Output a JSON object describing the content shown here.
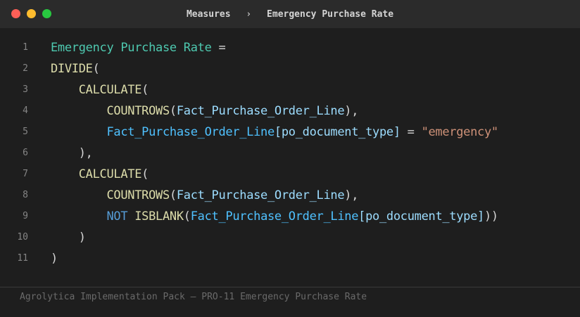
{
  "window": {
    "breadcrumb": [
      "Measures",
      "Emergency Purchase Rate"
    ],
    "breadcrumb_separator": "›",
    "traffic_lights": [
      "close",
      "minimize",
      "maximize"
    ]
  },
  "editor": {
    "line_numbers": [
      "1",
      "2",
      "3",
      "4",
      "5",
      "6",
      "7",
      "8",
      "9",
      "10",
      "11"
    ],
    "lines": [
      [
        {
          "t": "Emergency Purchase Rate",
          "c": "measure"
        },
        {
          "t": " =",
          "c": "op"
        }
      ],
      [
        {
          "t": "DIVIDE",
          "c": "func"
        },
        {
          "t": "(",
          "c": "op"
        }
      ],
      [
        {
          "t": "    ",
          "c": "op"
        },
        {
          "t": "CALCULATE",
          "c": "func"
        },
        {
          "t": "(",
          "c": "op"
        }
      ],
      [
        {
          "t": "        ",
          "c": "op"
        },
        {
          "t": "COUNTROWS",
          "c": "func"
        },
        {
          "t": "(",
          "c": "op"
        },
        {
          "t": "Fact_Purchase_Order_Line",
          "c": "col"
        },
        {
          "t": "),",
          "c": "op"
        }
      ],
      [
        {
          "t": "        ",
          "c": "op"
        },
        {
          "t": "Fact_Purchase_Order_Line",
          "c": "ref"
        },
        {
          "t": "[po_document_type]",
          "c": "col"
        },
        {
          "t": " = ",
          "c": "op"
        },
        {
          "t": "\"emergency\"",
          "c": "str"
        }
      ],
      [
        {
          "t": "    ),",
          "c": "op"
        }
      ],
      [
        {
          "t": "    ",
          "c": "op"
        },
        {
          "t": "CALCULATE",
          "c": "func"
        },
        {
          "t": "(",
          "c": "op"
        }
      ],
      [
        {
          "t": "        ",
          "c": "op"
        },
        {
          "t": "COUNTROWS",
          "c": "func"
        },
        {
          "t": "(",
          "c": "op"
        },
        {
          "t": "Fact_Purchase_Order_Line",
          "c": "col"
        },
        {
          "t": "),",
          "c": "op"
        }
      ],
      [
        {
          "t": "        ",
          "c": "op"
        },
        {
          "t": "NOT",
          "c": "kw"
        },
        {
          "t": " ",
          "c": "op"
        },
        {
          "t": "ISBLANK",
          "c": "func"
        },
        {
          "t": "(",
          "c": "op"
        },
        {
          "t": "Fact_Purchase_Order_Line",
          "c": "ref"
        },
        {
          "t": "[po_document_type]",
          "c": "col"
        },
        {
          "t": "))",
          "c": "op"
        }
      ],
      [
        {
          "t": "    )",
          "c": "op"
        }
      ],
      [
        {
          "t": ")",
          "c": "op"
        }
      ]
    ]
  },
  "footer": {
    "text": "Agrolytica Implementation Pack — PRO-11 Emergency Purchase Rate"
  },
  "colors": {
    "measure": "#4ec9b0",
    "func": "#dcdcaa",
    "ref": "#4fc1ff",
    "col": "#9cdcfe",
    "str": "#ce9178",
    "kw": "#569cd6",
    "op": "#d4d4d4"
  }
}
